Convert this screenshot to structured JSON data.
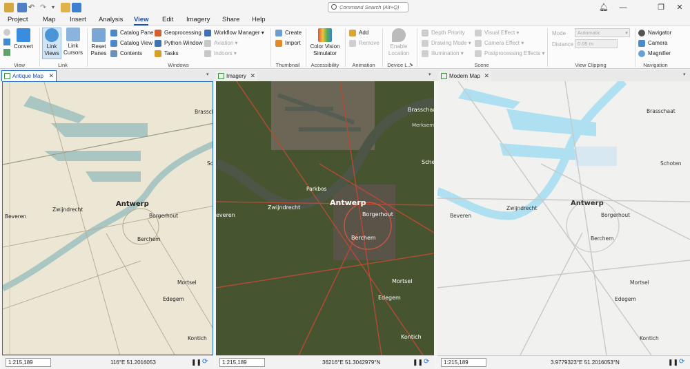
{
  "title": {
    "search_placeholder": "Command Search (Alt+Q)"
  },
  "tabs": [
    "Project",
    "Map",
    "Insert",
    "Analysis",
    "View",
    "Edit",
    "Imagery",
    "Share",
    "Help"
  ],
  "active_tab": "View",
  "ribbon": {
    "view": {
      "convert": "Convert",
      "label": "View"
    },
    "link": {
      "link_views": "Link Views",
      "link_cursors": "Link Cursors",
      "label": "Link"
    },
    "windows": {
      "reset_panes": "Reset Panes",
      "catalog_pane": "Catalog Pane",
      "catalog_view": "Catalog View",
      "contents": "Contents",
      "geoprocessing": "Geoprocessing",
      "python_window": "Python Window",
      "tasks": "Tasks",
      "workflow_manager": "Workflow Manager",
      "aviation": "Aviation",
      "indoors": "Indoors",
      "label": "Windows"
    },
    "thumbnail": {
      "create": "Create",
      "import": "Import",
      "label": "Thumbnail"
    },
    "accessibility": {
      "cvs": "Color Vision Simulator",
      "label": "Accessibility"
    },
    "animation": {
      "add": "Add",
      "remove": "Remove",
      "label": "Animation"
    },
    "device": {
      "enable_location": "Enable Location",
      "label": "Device L..."
    },
    "scene": {
      "depth_priority": "Depth Priority",
      "drawing_mode": "Drawing Mode",
      "illumination": "Illumination",
      "visual_effect": "Visual Effect",
      "camera_effect": "Camera Effect",
      "postprocessing": "Postprocessing Effects",
      "label": "Scene"
    },
    "clipping": {
      "mode_label": "Mode",
      "mode_value": "Automatic",
      "distance_label": "Distance",
      "distance_value": "0.05 m",
      "label": "View Clipping"
    },
    "navigation": {
      "navigator": "Navigator",
      "camera": "Camera",
      "magnifier": "Magnifier",
      "label": "Navigation"
    }
  },
  "panes": [
    {
      "tab": "Antique Map",
      "scale": "1:215,189",
      "coord": "116°E 51.2016053"
    },
    {
      "tab": "Imagery",
      "scale": "1:215,189",
      "coord": "36216°E 51.3042979°N"
    },
    {
      "tab": "Modern Map",
      "scale": "1:215,189",
      "coord": "3.9779323°E 51.2016053°N"
    }
  ],
  "maps": {
    "antique": {
      "antwerp": "Antwerp",
      "zwijndrecht": "Zwijndrecht",
      "borgerhout": "Borgerhout",
      "berchem": "Berchem",
      "mortsel": "Mortsel",
      "edegem": "Edegem",
      "kontich": "Kontich",
      "brasschaat": "Brasschaat",
      "beveren": "Beveren",
      "schoten": "Sche"
    },
    "imagery": {
      "antwerp": "Antwerp",
      "zwijndrecht": "Zwijndrecht",
      "borgerhout": "Borgerhout",
      "berchem": "Berchem",
      "mortsel": "Mortsel",
      "edegem": "Edegem",
      "kontich": "Kontich",
      "brasschaat": "Brasschaat",
      "merksem": "Merksem",
      "parkbos": "Parkbos",
      "beveren": "everen",
      "schoten": "Sche"
    },
    "modern": {
      "antwerp": "Antwerp",
      "zwijndrecht": "Zwijndrecht",
      "borgerhout": "Borgerhout",
      "berchem": "Berchem",
      "mortsel": "Mortsel",
      "edegem": "Edegem",
      "kontich": "Kontich",
      "brasschaat": "Brasschaat",
      "schoten": "Schoten",
      "beveren": "Beveren"
    }
  },
  "colors": {
    "accent": "#1a6fc9",
    "antique_bg": "#ece6d4",
    "antique_water": "#a9c6c2",
    "modern_bg": "#f1f1ef",
    "modern_water": "#aee0f2"
  }
}
